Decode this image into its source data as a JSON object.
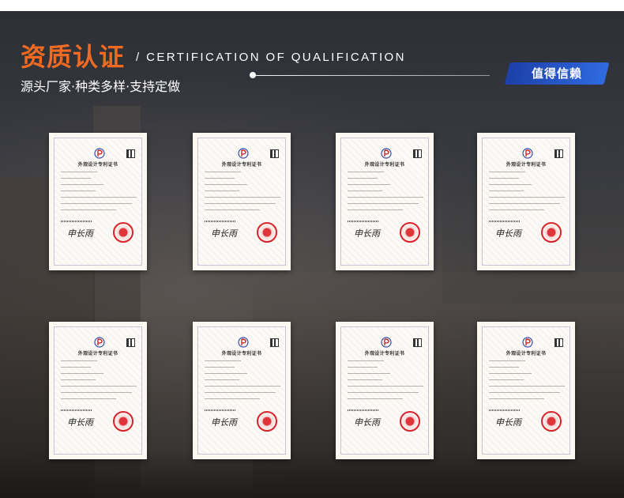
{
  "header": {
    "title_cn": "资质认证",
    "title_en": "/ CERTIFICATION OF QUALIFICATION",
    "subtitle": "源头厂家·种类多样·支持定做",
    "badge": "值得信赖"
  },
  "colors": {
    "accent_orange": "#f06a22",
    "badge_blue": "#2f6be0"
  },
  "certificates": [
    {
      "title": "外观设计专利证书",
      "signature": "申长雨",
      "seal": "red-seal-icon"
    },
    {
      "title": "外观设计专利证书",
      "signature": "申长雨",
      "seal": "red-seal-icon"
    },
    {
      "title": "外观设计专利证书",
      "signature": "申长雨",
      "seal": "red-seal-icon"
    },
    {
      "title": "外观设计专利证书",
      "signature": "申长雨",
      "seal": "red-seal-icon"
    },
    {
      "title": "外观设计专利证书",
      "signature": "申长雨",
      "seal": "red-seal-icon"
    },
    {
      "title": "外观设计专利证书",
      "signature": "申长雨",
      "seal": "red-seal-icon"
    },
    {
      "title": "外观设计专利证书",
      "signature": "申长雨",
      "seal": "red-seal-icon"
    },
    {
      "title": "外观设计专利证书",
      "signature": "申长雨",
      "seal": "red-seal-icon"
    }
  ]
}
